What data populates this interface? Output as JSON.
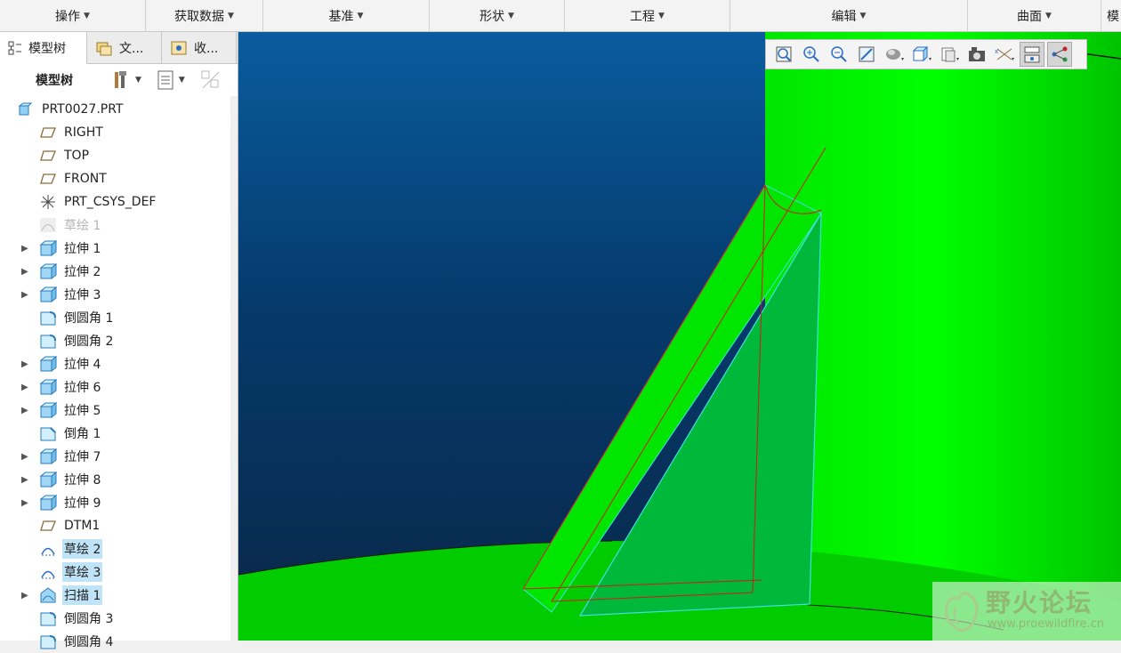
{
  "ribbon": {
    "groups": [
      "操作",
      "获取数据",
      "基准",
      "形状",
      "工程",
      "编辑",
      "曲面",
      "模"
    ]
  },
  "panel": {
    "tabs": [
      "模型树",
      "文...",
      "收..."
    ],
    "toolbar_title": "模型树"
  },
  "tree": {
    "root": "PRT0027.PRT",
    "items": [
      "RIGHT",
      "TOP",
      "FRONT",
      "PRT_CSYS_DEF",
      "草绘 1",
      "拉伸 1",
      "拉伸 2",
      "拉伸 3",
      "倒圆角 1",
      "倒圆角 2",
      "拉伸 4",
      "拉伸 6",
      "拉伸 5",
      "倒角 1",
      "拉伸 7",
      "拉伸 8",
      "拉伸 9",
      "DTM1",
      "草绘 2",
      "草绘 3",
      "扫描 1",
      "倒圆角 3",
      "倒圆角 4"
    ]
  },
  "watermark": {
    "title": "野火论坛",
    "url": "www.proewildfire.cn"
  },
  "colors": {
    "background_top": "#0a5c9e",
    "background_bottom": "#0a2748",
    "part_green": "#00e600",
    "highlight": "#bfe3f7"
  }
}
